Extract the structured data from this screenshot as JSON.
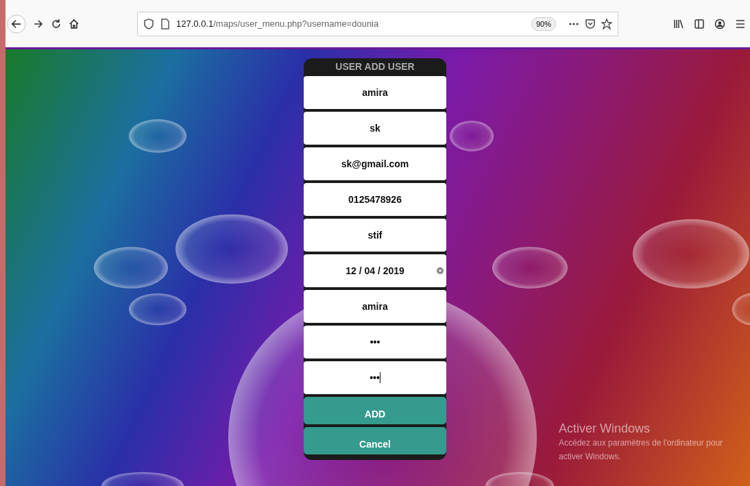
{
  "browser": {
    "url_host": "127.0.0.1",
    "url_path": "/maps/user_menu.php?username=dounia",
    "zoom": "90%"
  },
  "form": {
    "title": "USER ADD USER",
    "fields": [
      {
        "kind": "text",
        "value": "amira"
      },
      {
        "kind": "text",
        "value": "sk"
      },
      {
        "kind": "text",
        "value": "sk@gmail.com"
      },
      {
        "kind": "text",
        "value": "0125478926"
      },
      {
        "kind": "text",
        "value": "stif"
      },
      {
        "kind": "date",
        "value": "12 / 04 / 2019"
      },
      {
        "kind": "text",
        "value": "amira"
      },
      {
        "kind": "password",
        "value": "•••"
      },
      {
        "kind": "password",
        "value": "•••",
        "focused": true
      }
    ],
    "buttons": [
      "ADD",
      "Cancel"
    ]
  },
  "os_notice": {
    "title": "Activer Windows",
    "text": "Accédez aux paramètres de l'ordinateur pour activer Windows."
  }
}
